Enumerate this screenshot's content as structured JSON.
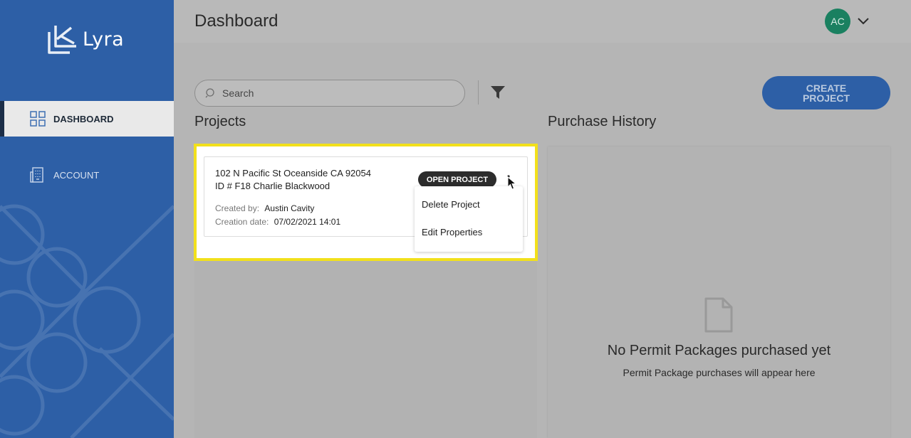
{
  "app": {
    "logo_text": "Lyra"
  },
  "sidebar": {
    "items": [
      {
        "label": "DASHBOARD",
        "icon": "grid-icon",
        "active": true
      },
      {
        "label": "ACCOUNT",
        "icon": "building-icon",
        "active": false
      }
    ]
  },
  "header": {
    "title": "Dashboard",
    "avatar_initials": "AC"
  },
  "toolbar": {
    "search_placeholder": "Search",
    "create_label": "CREATE\nPROJECT"
  },
  "projects": {
    "title": "Projects",
    "cards": [
      {
        "address": "102 N Pacific St Oceanside CA 92054",
        "id_line": "ID # F18 Charlie Blackwood",
        "created_by_label": "Created by:",
        "created_by": "Austin Cavity",
        "creation_date_label": "Creation date:",
        "creation_date": "07/02/2021 14:01",
        "open_label": "OPEN PROJECT"
      }
    ],
    "menu": [
      "Delete Project",
      "Edit Properties"
    ]
  },
  "history": {
    "title": "Purchase History",
    "empty_title": "No Permit Packages purchased yet",
    "empty_subtitle": "Permit Package purchases will appear here"
  },
  "colors": {
    "sidebar": "#2d5fa6",
    "highlight": "#f2e01b",
    "avatar": "#1a8060"
  }
}
